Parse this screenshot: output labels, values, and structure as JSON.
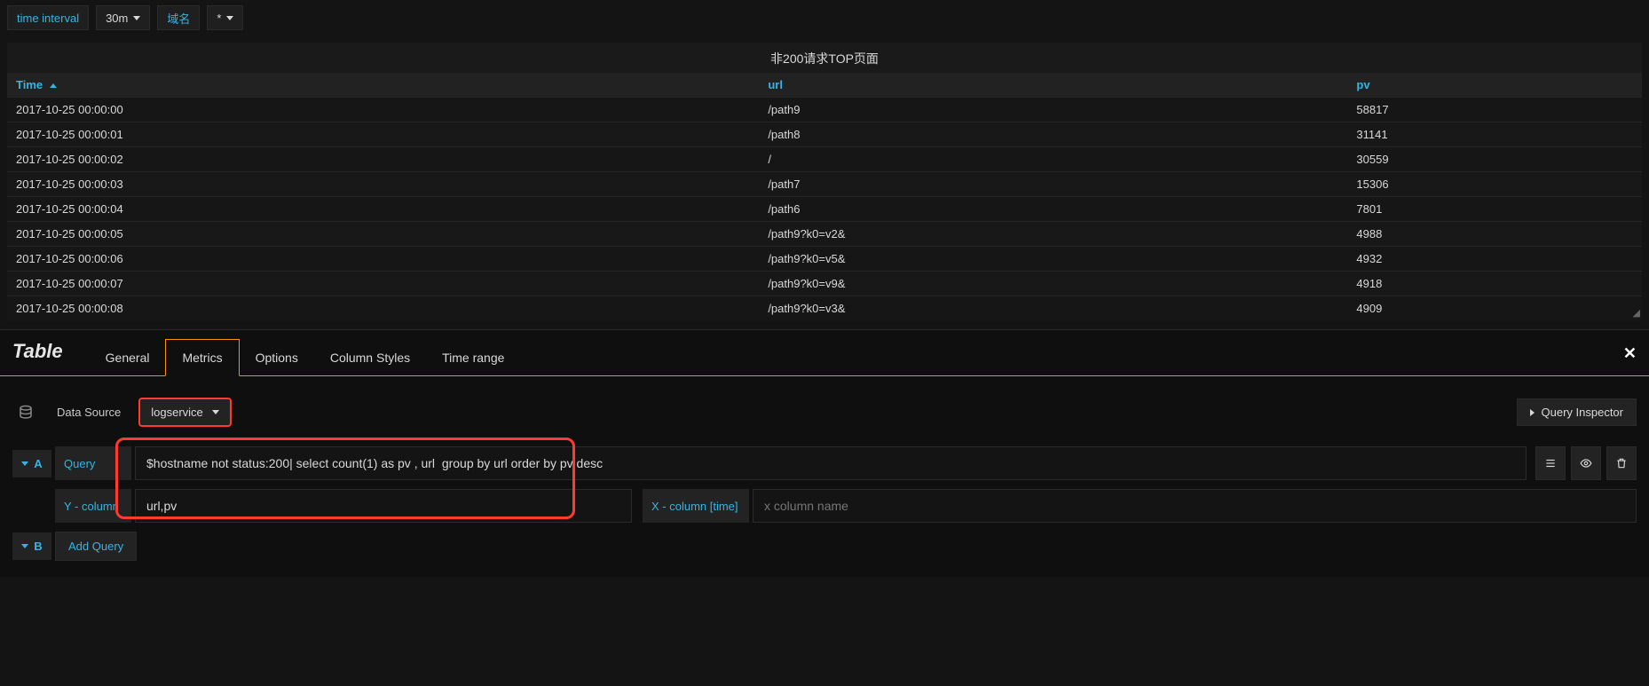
{
  "toolbar": {
    "time_interval_label": "time interval",
    "time_interval_value": "30m",
    "var2_label": "域名",
    "var2_value": "*"
  },
  "panel": {
    "title": "非200请求TOP页面",
    "columns": {
      "time": "Time",
      "url": "url",
      "pv": "pv"
    },
    "rows": [
      {
        "time": "2017-10-25 00:00:00",
        "url": "/path9",
        "pv": "58817"
      },
      {
        "time": "2017-10-25 00:00:01",
        "url": "/path8",
        "pv": "31141"
      },
      {
        "time": "2017-10-25 00:00:02",
        "url": "/",
        "pv": "30559"
      },
      {
        "time": "2017-10-25 00:00:03",
        "url": "/path7",
        "pv": "15306"
      },
      {
        "time": "2017-10-25 00:00:04",
        "url": "/path6",
        "pv": "7801"
      },
      {
        "time": "2017-10-25 00:00:05",
        "url": "/path9?k0=v2&",
        "pv": "4988"
      },
      {
        "time": "2017-10-25 00:00:06",
        "url": "/path9?k0=v5&",
        "pv": "4932"
      },
      {
        "time": "2017-10-25 00:00:07",
        "url": "/path9?k0=v9&",
        "pv": "4918"
      },
      {
        "time": "2017-10-25 00:00:08",
        "url": "/path9?k0=v3&",
        "pv": "4909"
      }
    ]
  },
  "editor": {
    "title": "Table",
    "tabs": {
      "general": "General",
      "metrics": "Metrics",
      "options": "Options",
      "column_styles": "Column Styles",
      "time_range": "Time range"
    },
    "datasource_label": "Data Source",
    "datasource_value": "logservice",
    "query_inspector": "Query Inspector",
    "row_a": {
      "letter": "A",
      "query_label": "Query",
      "query_value": "$hostname not status:200| select count(1) as pv , url  group by url order by pv desc",
      "ycol_label": "Y - column",
      "ycol_value": "url,pv",
      "xcol_label": "X - column [time]",
      "xcol_placeholder": "x column name"
    },
    "row_b": {
      "letter": "B",
      "add_query": "Add Query"
    }
  }
}
